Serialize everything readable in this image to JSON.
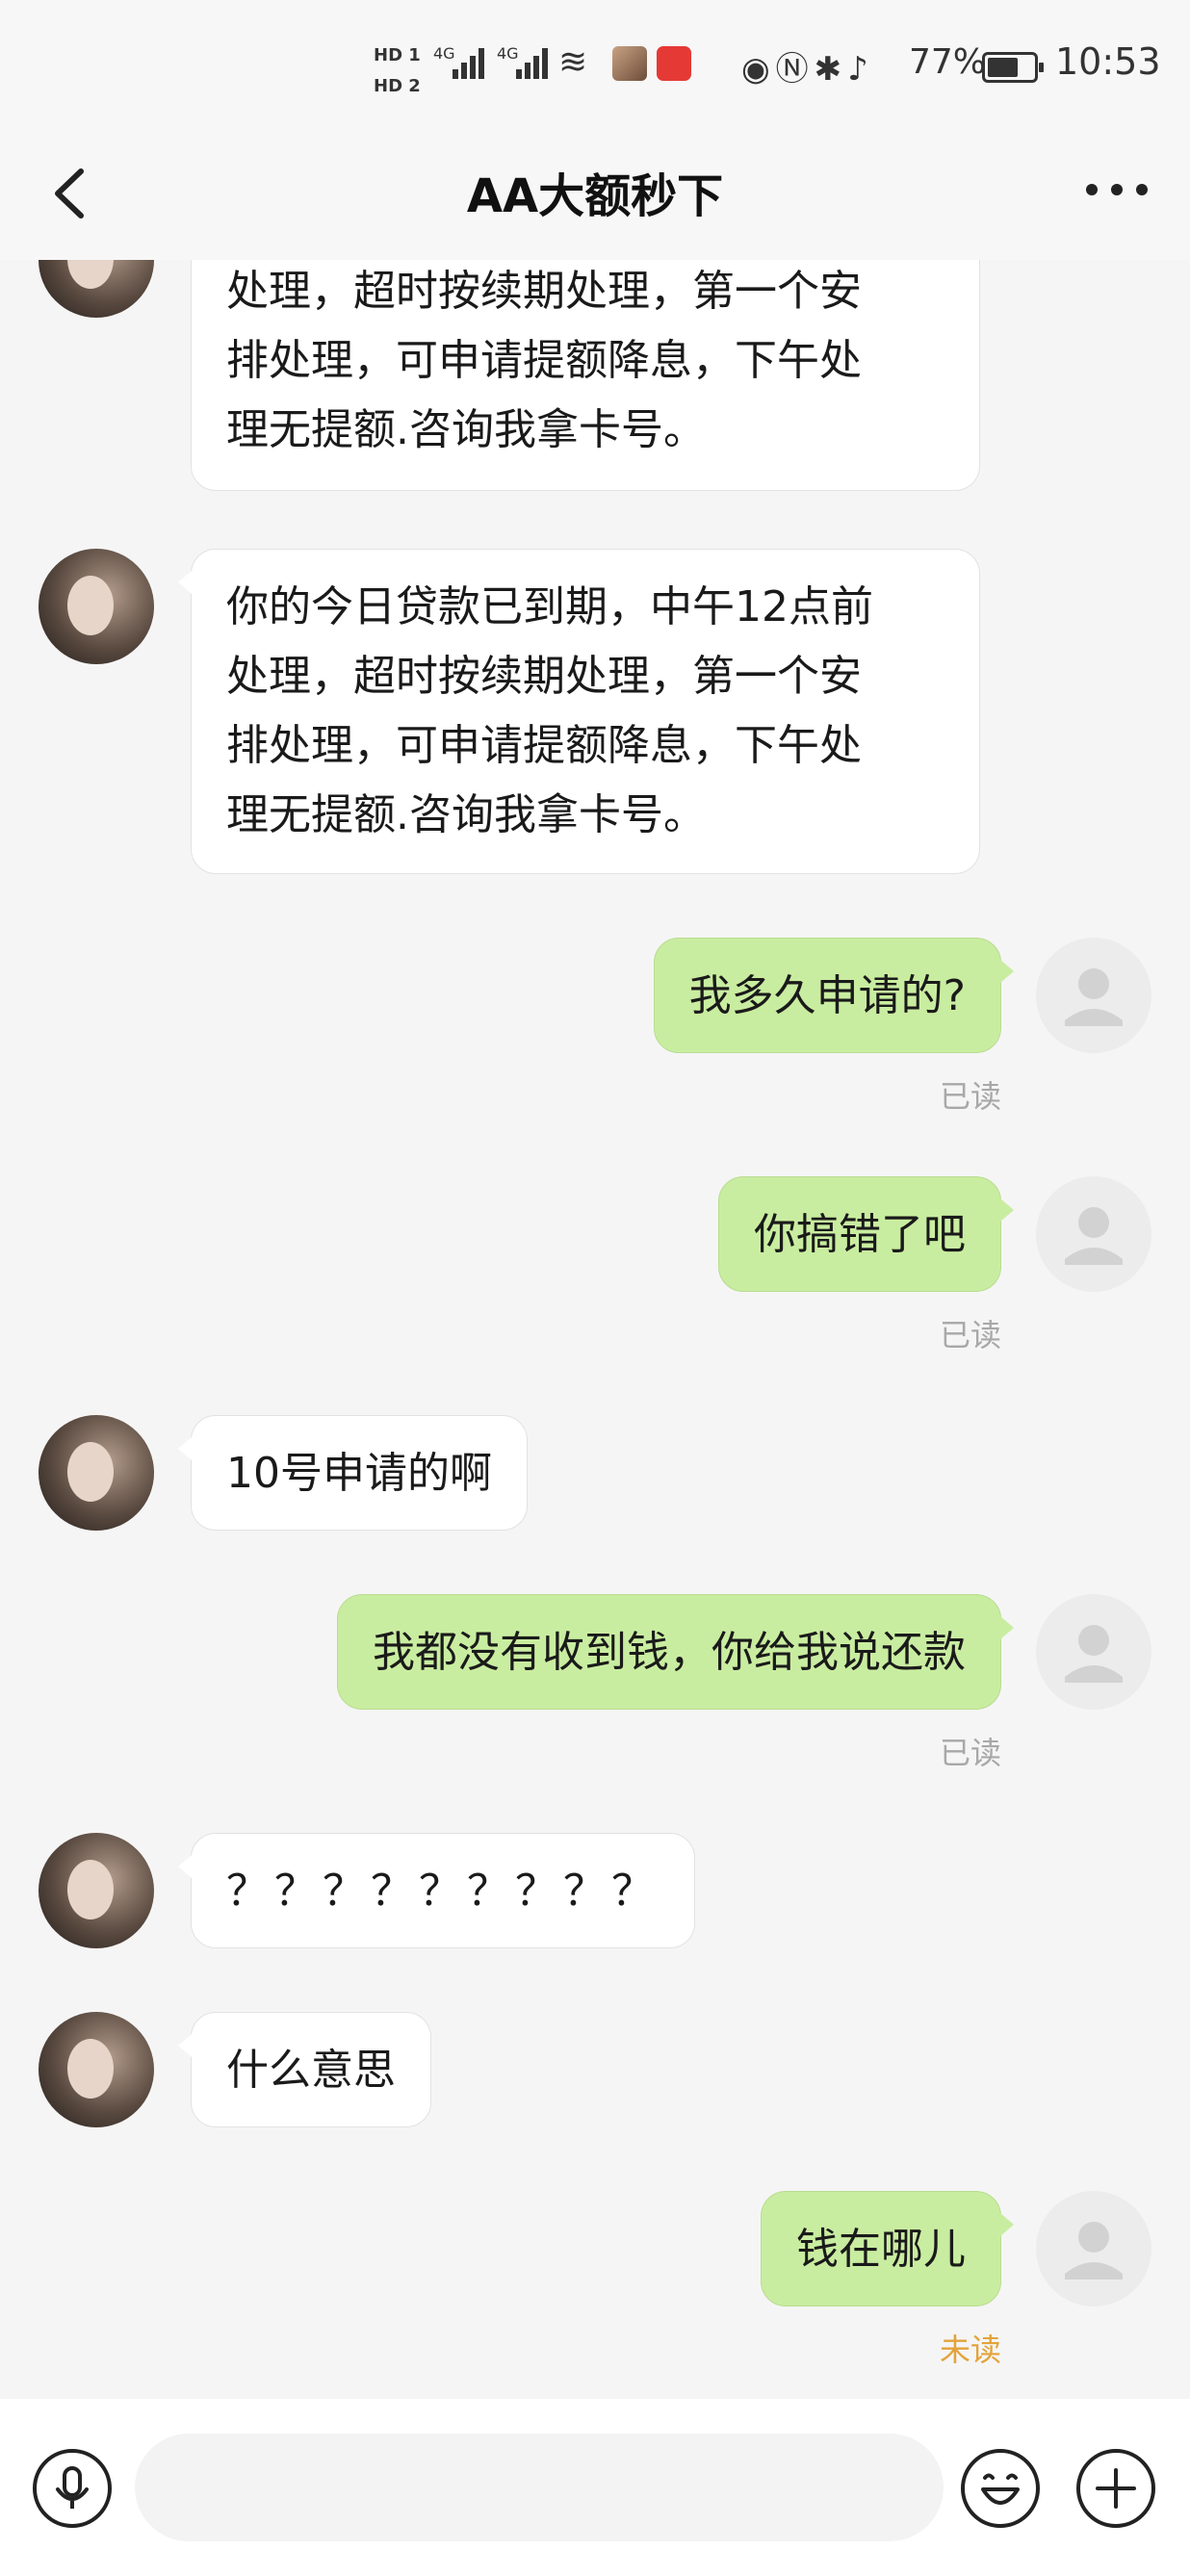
{
  "status_bar": {
    "hd1": "HD 1",
    "hd2": "HD 2",
    "net1": "4G",
    "net2": "4G",
    "battery": "77%",
    "battery_level": 0.77,
    "time": "10:53"
  },
  "header": {
    "title": "AA大额秒下"
  },
  "messages": [
    {
      "side": "left",
      "text": "处理，超时按续期处理，第一个安\n排处理，可申请提额降息，下午处\n理无提额.咨询我拿卡号。"
    },
    {
      "side": "left",
      "text": "你的今日贷款已到期，中午12点前\n处理，超时按续期处理，第一个安\n排处理，可申请提额降息，下午处\n理无提额.咨询我拿卡号。"
    },
    {
      "side": "right",
      "text": "我多久申请的?",
      "status": "已读"
    },
    {
      "side": "right",
      "text": "你搞错了吧",
      "status": "已读"
    },
    {
      "side": "left",
      "text": "10号申请的啊"
    },
    {
      "side": "right",
      "text": "我都没有收到钱，你给我说还款",
      "status": "已读"
    },
    {
      "side": "left",
      "text": "？？？？？？？？？"
    },
    {
      "side": "left",
      "text": "什么意思"
    },
    {
      "side": "right",
      "text": "钱在哪儿",
      "status": "未读"
    }
  ],
  "input": {
    "placeholder": ""
  },
  "colors": {
    "bubble_sent": "#c9eda0",
    "bubble_received": "#ffffff",
    "read_status": "#a8a8a8",
    "unread_status": "#e3a33a"
  }
}
